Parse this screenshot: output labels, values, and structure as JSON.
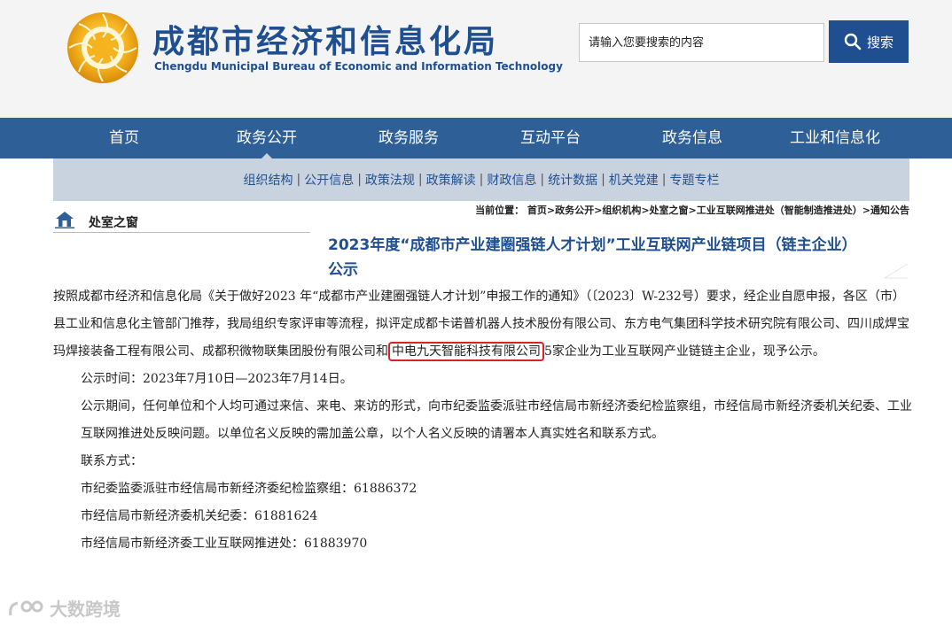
{
  "header": {
    "title": "成都市经济和信息化局",
    "subtitle": "Chengdu Municipal Bureau of Economic and Information Technology",
    "search_placeholder": "请输入您要搜索的内容",
    "search_button": "搜索"
  },
  "main_nav": {
    "items": [
      "首页",
      "政务公开",
      "政务服务",
      "互动平台",
      "政务信息",
      "工业和信息化"
    ],
    "active": "政务公开"
  },
  "sub_nav": {
    "items": [
      "组织结构",
      "公开信息",
      "政策法规",
      "政策解读",
      "财政信息",
      "统计数据",
      "机关党建",
      "专题专栏"
    ]
  },
  "section": {
    "title": "处室之窗"
  },
  "breadcrumb": "当前位置： 首页>政务公开>组织机构>处室之窗>工业互联网推进处（智能制造推进处）>通知公告",
  "article": {
    "title_line1": "2023年度“成都市产业建圈强链人才计划”工业互联网产业链项目（链主企业）",
    "title_line2": "公示",
    "p1_before": "按照成都市经济和信息化局《关于做好2023 年“成都市产业建圈强链人才计划”申报工作的通知》（〔2023〕W-232号）要求，经企业自愿申报，各区（市）县工业和信息化主管部门推荐，我局组织专家评审等流程，拟评定成都卡诺普机器人技术股份有限公司、东方电气集团科学技术研究院有限公司、四川成焊宝玛焊接装备工程有限公司、成都积微物联集团股份有限公司和",
    "p1_highlight": "中电九天智能科技有限公司",
    "p1_after": "5家企业为工业互联网产业链链主企业，现予公示。",
    "p2": "公示时间：2023年7月10日—2023年7月14日。",
    "p3": "公示期间，任何单位和个人均可通过来信、来电、来访的形式，向市纪委监委派驻市经信局市新经济委纪检监察组，市经信局市新经济委机关纪委、工业互联网推进处反映问题。以单位名义反映的需加盖公章，以个人名义反映的请署本人真实姓名和联系方式。",
    "p4": "联系方式：",
    "p5": "市纪委监委派驻市经信局市新经济委纪检监察组：61886372",
    "p6": "市经信局市新经济委机关纪委：61881624",
    "p7": "市经信局市新经济委工业互联网推进处：61883970"
  },
  "watermark": "大数跨境",
  "colors": {
    "brand_blue": "#1f4f91",
    "nav_blue": "#2e5f96",
    "subnav_bg": "#c9d3e0",
    "highlight_red": "#e02020"
  },
  "icons": [
    "logo-emblem-icon",
    "search-icon",
    "home-icon"
  ]
}
